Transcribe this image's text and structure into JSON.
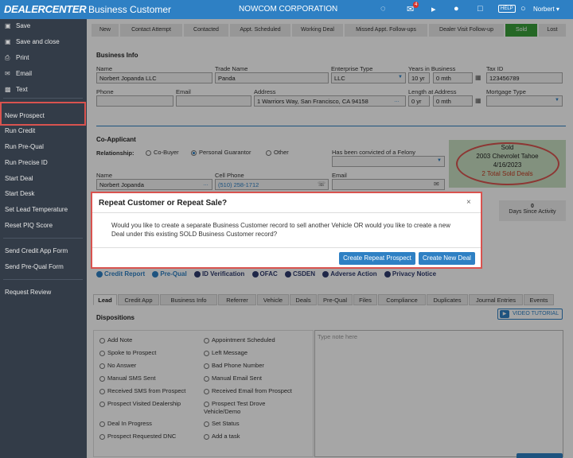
{
  "header": {
    "logo": "DEALERCENTER",
    "app_title": "Business Customer",
    "corporation": "NOWCOM CORPORATION",
    "badge_count": "4",
    "help": "HELP",
    "user": "Norbert ▾",
    "icons": [
      "chat-icon",
      "message-icon",
      "megaphone-icon",
      "bell-icon",
      "clipboard-icon",
      "help-icon",
      "user-icon"
    ]
  },
  "sidebar": {
    "actions": [
      {
        "label": "Save",
        "icon": "save-icon"
      },
      {
        "label": "Save and close",
        "icon": "save-close-icon"
      },
      {
        "label": "Print",
        "icon": "print-icon"
      },
      {
        "label": "Email",
        "icon": "email-icon"
      },
      {
        "label": "Text",
        "icon": "sms-icon"
      }
    ],
    "items": [
      "New Prospect",
      "Run Credit",
      "Run Pre-Qual",
      "Run Precise ID",
      "Start Deal",
      "Start Desk",
      "Set Lead Temperature",
      "Reset PIQ Score",
      "Send Credit App Form",
      "Send Pre-Qual Form",
      "Request Review"
    ]
  },
  "stages": [
    "New",
    "Contact Attempt",
    "Contacted",
    "Appt. Scheduled",
    "Working Deal",
    "Missed Appt. Follow-ups",
    "Dealer Visit Follow-up",
    "Sold",
    "Lost"
  ],
  "business": {
    "section": "Business Info",
    "name_label": "Name",
    "name": "Norbert Jopanda LLC",
    "trade_label": "Trade Name",
    "trade": "Panda",
    "entity_label": "Enterprise Type",
    "entity": "LLC",
    "years_label": "Years in Business",
    "years": "10 yr",
    "months": "0 mth",
    "taxid_label": "Tax ID",
    "taxid": "123456789",
    "phone_label": "Phone",
    "email_label": "Email",
    "address_label": "Address",
    "address": "1 Warriors Way, San Francisco, CA 94158",
    "len_label": "Length at Address",
    "len_years": "0 yr",
    "len_months": "0 mth",
    "mortgage_label": "Mortgage Type"
  },
  "coapp": {
    "section": "Co-Applicant",
    "relationship_label": "Relationship:",
    "options": [
      "Co-Buyer",
      "Personal Guarantor",
      "Other"
    ],
    "felony_label": "Has been convicted of a Felony",
    "name_label": "Name",
    "name": "Norbert Jopanda",
    "cell_label": "Cell Phone",
    "cell": "(510) 258-1712",
    "email_label": "Email"
  },
  "sold": {
    "status": "Sold",
    "vehicle": "2003 Chevrolet Tahoe",
    "date": "4/16/2023",
    "total": "2 Total Sold Deals"
  },
  "stats": {
    "activity_value": "0",
    "activity_label": "Days Since Activity"
  },
  "quicklinks": [
    "Credit Report",
    "Pre-Qual",
    "ID Verification",
    "OFAC",
    "CSDEN",
    "Adverse Action",
    "Privacy Notice"
  ],
  "tabs": [
    "Lead",
    "Credit App",
    "Business Info",
    "Referrer",
    "Vehicle",
    "Deals",
    "Pre-Qual",
    "Files",
    "Compliance",
    "Duplicates",
    "Journal Entries",
    "Events"
  ],
  "dispositions": {
    "title": "Dispositions",
    "video_tutorial": "VIDEO TUTORIAL",
    "left": [
      "Add Note",
      "Spoke to Prospect",
      "No Answer",
      "Manual SMS Sent",
      "Received SMS from Prospect",
      "Prospect Visited Dealership",
      "Deal In Progress",
      "Prospect Requested DNC"
    ],
    "right": [
      "Appointment Scheduled",
      "Left Message",
      "Bad Phone Number",
      "Manual Email Sent",
      "Received Email from Prospect",
      "Prospect Test Drove Vehicle/Demo",
      "Set Status",
      "Add a task"
    ],
    "note_placeholder": "Type note here"
  },
  "modal": {
    "title": "Repeat Customer or Repeat Sale?",
    "close": "×",
    "body": "Would you like to create a separate Business Customer record to sell another Vehicle OR would you like to create a new Deal under this existing SOLD Business Customer record?",
    "btn_repeat_prospect": "Create Repeat Prospect",
    "btn_new_deal": "Create New Deal"
  }
}
